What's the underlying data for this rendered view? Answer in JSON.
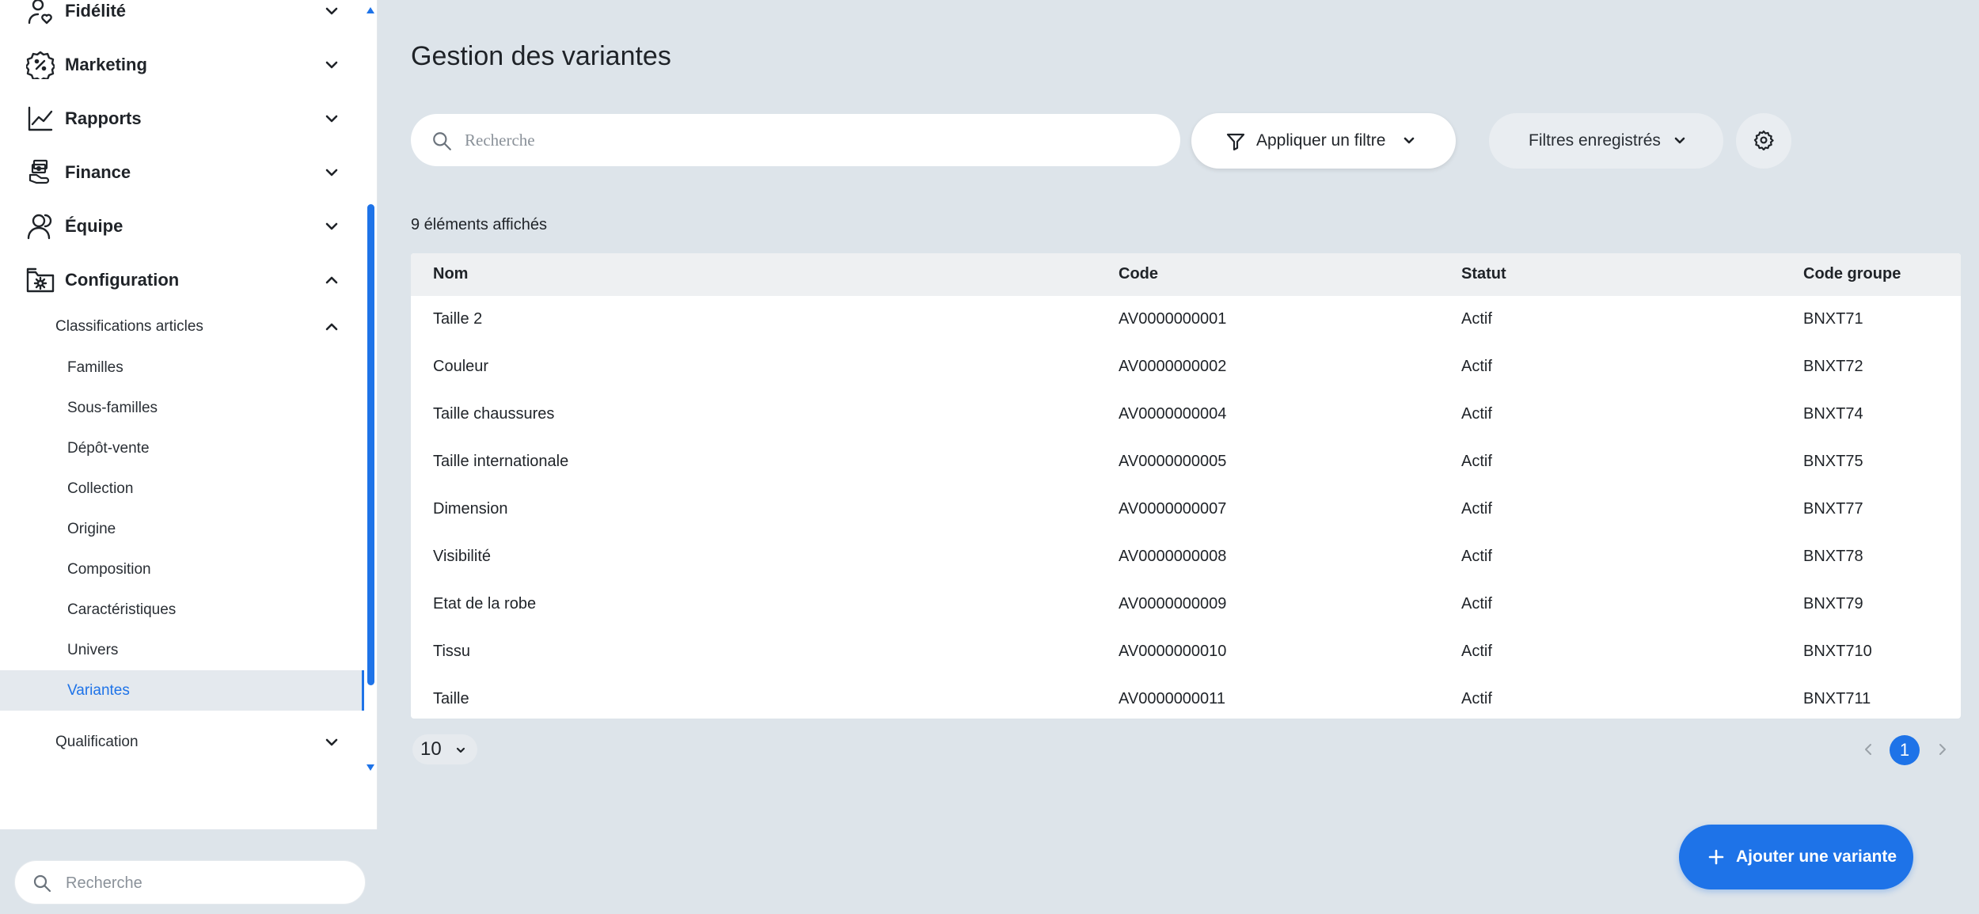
{
  "sidebar": {
    "main_items": [
      {
        "label": "Fidélité",
        "icon": "loyalty-icon",
        "expanded": false
      },
      {
        "label": "Marketing",
        "icon": "percent-badge-icon",
        "expanded": false
      },
      {
        "label": "Rapports",
        "icon": "line-chart-icon",
        "expanded": false
      },
      {
        "label": "Finance",
        "icon": "money-hand-icon",
        "expanded": false
      },
      {
        "label": "Équipe",
        "icon": "team-icon",
        "expanded": false
      },
      {
        "label": "Configuration",
        "icon": "folder-gear-icon",
        "expanded": true
      }
    ],
    "sub_group": {
      "label": "Classifications articles",
      "expanded": true
    },
    "leaf_items": [
      {
        "label": "Familles"
      },
      {
        "label": "Sous-familles"
      },
      {
        "label": "Dépôt-vente"
      },
      {
        "label": "Collection"
      },
      {
        "label": "Origine"
      },
      {
        "label": "Composition"
      },
      {
        "label": "Caractéristiques"
      },
      {
        "label": "Univers"
      },
      {
        "label": "Variantes",
        "active": true
      }
    ],
    "sub_group_2": {
      "label": "Qualification",
      "expanded": false
    },
    "search_placeholder": "Recherche"
  },
  "main": {
    "title": "Gestion des variantes",
    "search_placeholder": "Recherche",
    "filter_button": "Appliquer un filtre",
    "saved_filters_button": "Filtres enregistrés",
    "count_text": "9 éléments affichés",
    "table": {
      "headers": [
        "Nom",
        "Code",
        "Statut",
        "Code groupe"
      ],
      "rows": [
        [
          "Taille 2",
          "AV0000000001",
          "Actif",
          "BNXT71"
        ],
        [
          "Couleur",
          "AV0000000002",
          "Actif",
          "BNXT72"
        ],
        [
          "Taille chaussures",
          "AV0000000004",
          "Actif",
          "BNXT74"
        ],
        [
          "Taille internationale",
          "AV0000000005",
          "Actif",
          "BNXT75"
        ],
        [
          "Dimension",
          "AV0000000007",
          "Actif",
          "BNXT77"
        ],
        [
          "Visibilité",
          "AV0000000008",
          "Actif",
          "BNXT78"
        ],
        [
          "Etat de la robe",
          "AV0000000009",
          "Actif",
          "BNXT79"
        ],
        [
          "Tissu",
          "AV0000000010",
          "Actif",
          "BNXT710"
        ],
        [
          "Taille",
          "AV0000000011",
          "Actif",
          "BNXT711"
        ]
      ]
    },
    "page_size": "10",
    "current_page": "1",
    "add_button": "Ajouter une variante"
  },
  "colors": {
    "accent": "#1e73e8",
    "background": "#dde4ea",
    "sidebar_bg": "#ffffff",
    "active_item_bg": "#e4e9ee"
  }
}
